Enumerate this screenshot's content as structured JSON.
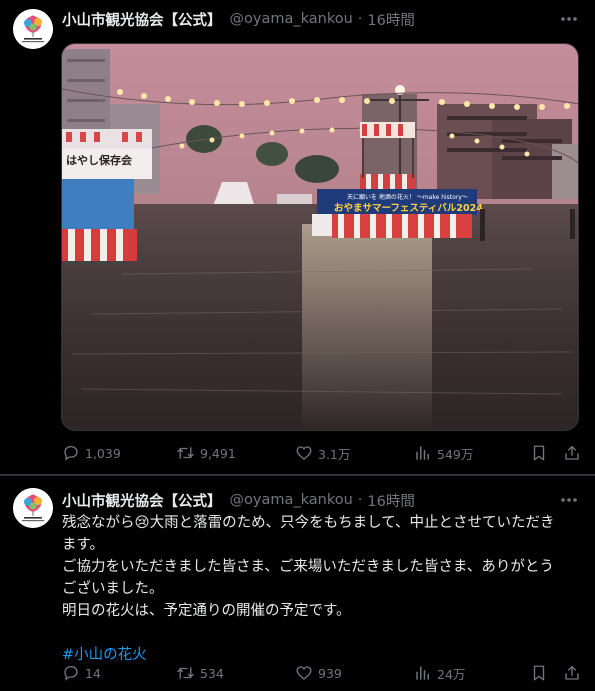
{
  "posts": [
    {
      "author": {
        "name": "小山市観光協会【公式】",
        "handle": "@oyama_kankou",
        "time": "16時間"
      },
      "separator": "·",
      "photo": {
        "banner": "おやまサマーフェスティバル2024",
        "banner_top": "天に願いを 地酒の花火！ ～make history～",
        "stall_sign": "はやし保存会"
      },
      "stats": {
        "replies": "1,039",
        "retweets": "9,491",
        "likes": "3.1万",
        "views": "549万"
      }
    },
    {
      "author": {
        "name": "小山市観光協会【公式】",
        "handle": "@oyama_kankou",
        "time": "16時間"
      },
      "separator": "·",
      "text": {
        "line1_before": "残念ながら",
        "line1_emoji": "😢",
        "line1_after": "大雨と落雷のため、只今をもちまして、中止とさせていただき",
        "line2": "ます。",
        "line3": "ご協力をいただきました皆さま、ご来場いただきました皆さま、ありがとう",
        "line4": "ございました。",
        "line5": "明日の花火は、予定通りの開催の予定です。",
        "hashtag": "#小山の花火"
      },
      "stats": {
        "replies": "14",
        "retweets": "534",
        "likes": "939",
        "views": "24万"
      }
    }
  ],
  "colors": {
    "background": "#000000",
    "text": "#e7e9ea",
    "muted": "#71767b",
    "link": "#1d9bf0",
    "divider": "#2f3336"
  },
  "icons": [
    "more-icon",
    "reply-icon",
    "retweet-icon",
    "like-icon",
    "views-icon",
    "bookmark-icon",
    "share-icon"
  ]
}
